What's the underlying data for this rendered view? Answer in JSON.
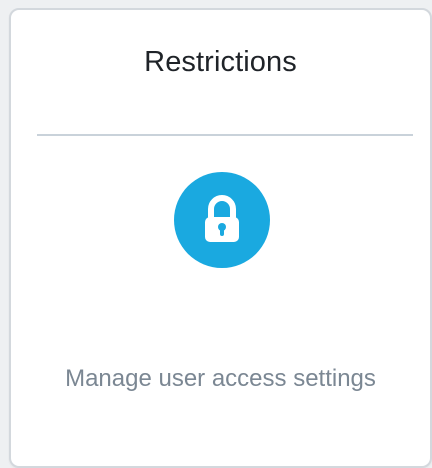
{
  "card": {
    "title": "Restrictions",
    "icon": "lock-icon",
    "description": "Manage user access settings",
    "accent_color": "#1aa9e0"
  }
}
